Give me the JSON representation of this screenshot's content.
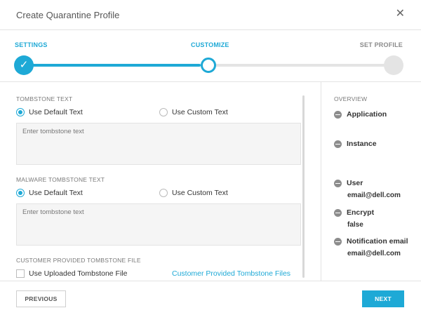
{
  "dialog": {
    "title": "Create Quarantine Profile",
    "close_glyph": "✕"
  },
  "steps": [
    {
      "label": "SETTINGS",
      "state": "complete",
      "check_glyph": "✓"
    },
    {
      "label": "CUSTOMIZE",
      "state": "active"
    },
    {
      "label": "SET PROFILE",
      "state": "pending"
    }
  ],
  "tombstone": {
    "heading": "TOMBSTONE TEXT",
    "option_default": "Use Default Text",
    "option_custom": "Use Custom Text",
    "selected": "default",
    "placeholder": "Enter tombstone text"
  },
  "malware_tombstone": {
    "heading": "MALWARE TOMBSTONE TEXT",
    "option_default": "Use Default Text",
    "option_custom": "Use Custom Text",
    "selected": "default",
    "placeholder": "Enter tombstone text"
  },
  "customer_file": {
    "heading": "CUSTOMER PROVIDED TOMBSTONE FILE",
    "checkbox_label": "Use Uploaded Tombstone File",
    "checked": false,
    "link_text": "Customer Provided Tombstone Files"
  },
  "overview": {
    "heading": "OVERVIEW",
    "items": [
      {
        "label": "Application",
        "value": ""
      },
      {
        "label": "Instance",
        "value": ""
      },
      {
        "label": "User",
        "value": "email@dell.com"
      },
      {
        "label": "Encrypt",
        "value": "false"
      },
      {
        "label": "Notification email",
        "value": "email@dell.com"
      }
    ]
  },
  "footer": {
    "previous_label": "PREVIOUS",
    "next_label": "NEXT"
  },
  "colors": {
    "accent": "#1ea9d6",
    "pending": "#e4e4e4",
    "overview_icon": "#8c8c8c"
  },
  "icons": {
    "close": "close-icon",
    "step_complete": "checkmark-icon",
    "overview_item": "minus-circle-icon"
  }
}
